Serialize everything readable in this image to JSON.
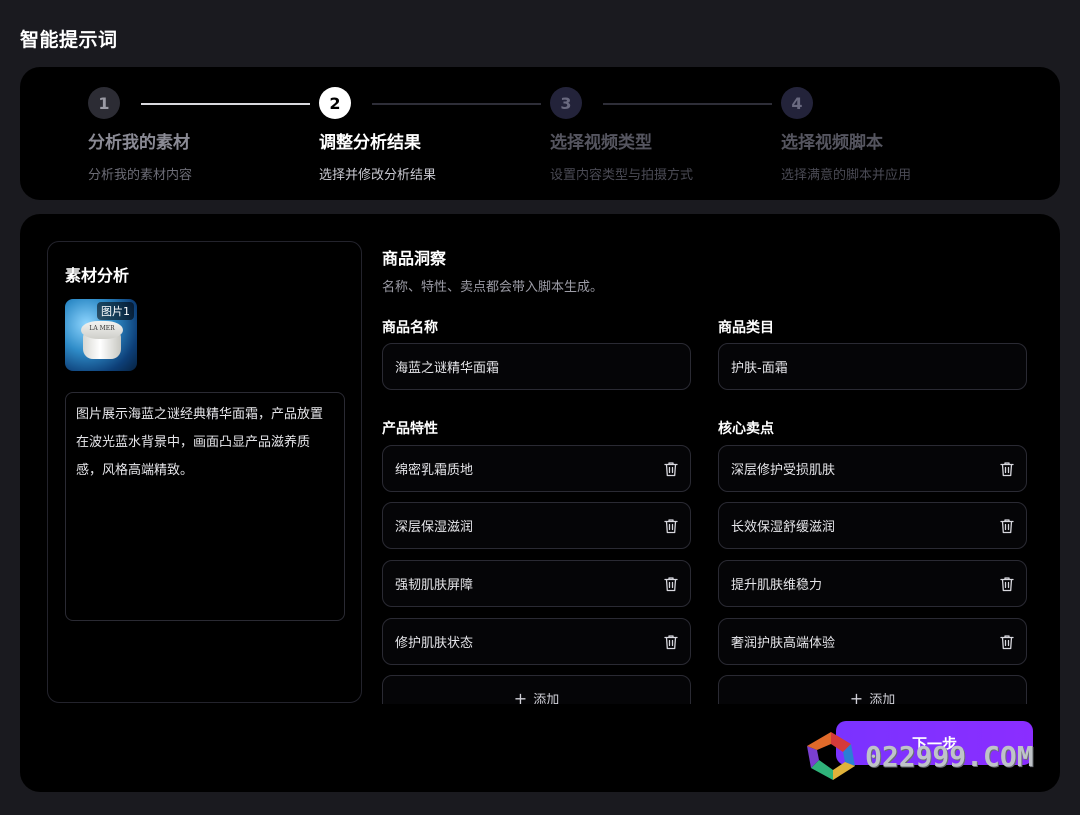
{
  "page": {
    "title": "智能提示词"
  },
  "steps": [
    {
      "number": "1",
      "title": "分析我的素材",
      "subtitle": "分析我的素材内容",
      "state": "done"
    },
    {
      "number": "2",
      "title": "调整分析结果",
      "subtitle": "选择并修改分析结果",
      "state": "active"
    },
    {
      "number": "3",
      "title": "选择视频类型",
      "subtitle": "设置内容类型与拍摄方式",
      "state": "todo"
    },
    {
      "number": "4",
      "title": "选择视频脚本",
      "subtitle": "选择满意的脚本并应用",
      "state": "todo"
    }
  ],
  "material": {
    "title": "素材分析",
    "image_badge": "图片1",
    "image_brand": "LA MER",
    "description": "图片展示海蓝之谜经典精华面霜，产品放置在波光蓝水背景中，画面凸显产品滋养质感，风格高端精致。"
  },
  "insight": {
    "title": "商品洞察",
    "subtitle": "名称、特性、卖点都会带入脚本生成。",
    "name_label": "商品名称",
    "name_value": "海蓝之谜精华面霜",
    "category_label": "商品类目",
    "category_value": "护肤-面霜",
    "features_label": "产品特性",
    "features": [
      "绵密乳霜质地",
      "深层保湿滋润",
      "强韧肌肤屏障",
      "修护肌肤状态"
    ],
    "selling_label": "核心卖点",
    "selling_points": [
      "深层修护受损肌肤",
      "长效保湿舒缓滋润",
      "提升肌肤维稳力",
      "奢润护肤高端体验"
    ],
    "add_label": "添加"
  },
  "actions": {
    "next_label": "下一步"
  },
  "watermark": {
    "text": "022999.COM"
  },
  "colors": {
    "accent": "#7a33ff",
    "background": "#1a1a1f",
    "card": "#000000"
  },
  "icons": {
    "delete": "trash-icon",
    "add": "plus-icon"
  }
}
